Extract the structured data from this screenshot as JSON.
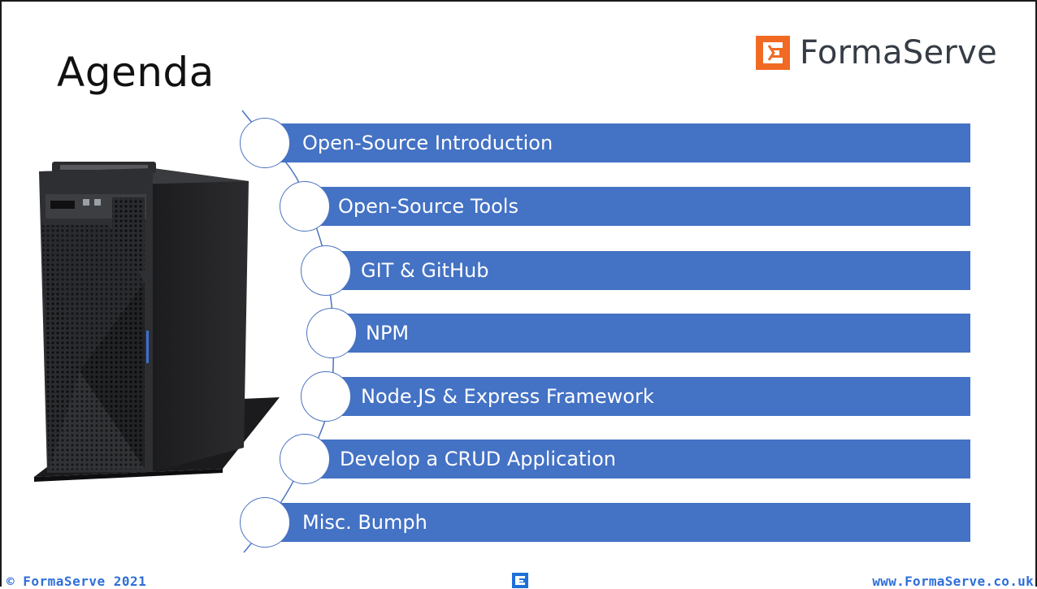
{
  "slide": {
    "title": "Agenda",
    "brand": {
      "name": "FormaServe",
      "mark_color": "#f06a24",
      "accent": "#4472c4"
    },
    "items": [
      {
        "label": "Open-Source Introduction"
      },
      {
        "label": "Open-Source Tools"
      },
      {
        "label": "GIT & GitHub"
      },
      {
        "label": "NPM"
      },
      {
        "label": "Node.JS & Express Framework"
      },
      {
        "label": "Develop a CRUD Application"
      },
      {
        "label": "Misc. Bumph"
      }
    ],
    "image": "tower-server-image",
    "footer": {
      "copyright": "© FormaServe 2021",
      "website": "www.FormaServe.co.uk"
    }
  }
}
